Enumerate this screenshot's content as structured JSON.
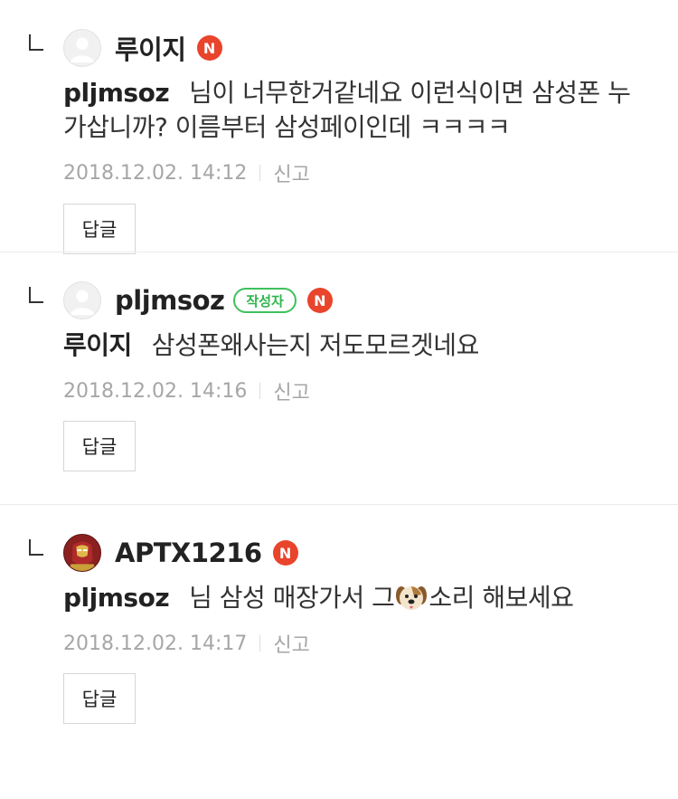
{
  "comments": [
    {
      "nickname": "루이지",
      "new_badge": "N",
      "mention": "pljmsoz",
      "text": "님이 너무한거같네요 이런식이면 삼성폰 누가삽니까? 이름부터 삼성페이인데 ㅋㅋㅋㅋ",
      "date": "2018.12.02. 14:12",
      "report_label": "신고",
      "reply_label": "답글",
      "avatar_icon": "default-profile-icon"
    },
    {
      "nickname": "pljmsoz",
      "author_badge": "작성자",
      "new_badge": "N",
      "mention": "루이지",
      "text": "삼성폰왜사는지 저도모르겟네요",
      "date": "2018.12.02. 14:16",
      "report_label": "신고",
      "reply_label": "답글",
      "avatar_icon": "default-profile-icon"
    },
    {
      "nickname": "APTX1216",
      "new_badge": "N",
      "mention": "pljmsoz",
      "text_before": "님 삼성 매장가서 그",
      "emoji": "dog-face-emoji",
      "text_after": "소리 해보세요",
      "date": "2018.12.02. 14:17",
      "report_label": "신고",
      "reply_label": "답글",
      "avatar_icon": "ironman-profile-icon"
    }
  ],
  "colors": {
    "new_badge": "#e9442c",
    "author_badge": "#3ec15d",
    "meta_text": "#a6a6a6",
    "divider": "#ebebeb"
  }
}
